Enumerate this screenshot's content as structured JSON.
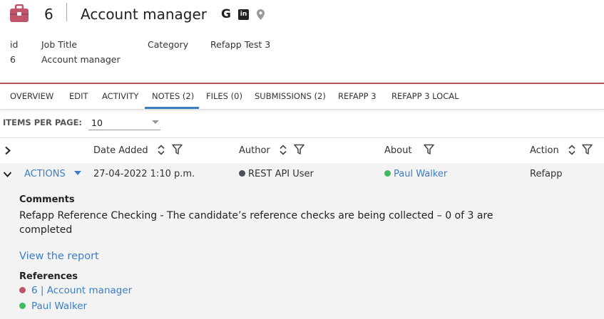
{
  "header": {
    "record_id": "6",
    "title": "Account manager",
    "google_glyph": "G",
    "linkedin_glyph": "in"
  },
  "fields": [
    {
      "label": "id",
      "value": "6"
    },
    {
      "label": "Job Title",
      "value": "Account manager"
    },
    {
      "label": "Category",
      "value": "Refapp Test 3"
    }
  ],
  "tabs": [
    {
      "label": "OVERVIEW"
    },
    {
      "label": "EDIT"
    },
    {
      "label": "ACTIVITY"
    },
    {
      "label": "NOTES (2)",
      "active": true
    },
    {
      "label": "FILES (0)"
    },
    {
      "label": "SUBMISSIONS (2)"
    },
    {
      "label": "REFAPP 3"
    },
    {
      "label": "REFAPP 3 LOCAL"
    }
  ],
  "pagination": {
    "label": "ITEMS PER PAGE:",
    "value": "10"
  },
  "table": {
    "columns": {
      "date_added": "Date Added",
      "author": "Author",
      "about": "About",
      "action": "Action"
    },
    "row": {
      "actions_label": "ACTIONS",
      "date_added": "27-04-2022 1:10 p.m.",
      "author": "REST API User",
      "about": "Paul Walker",
      "action": "Refapp",
      "comments_title": "Comments",
      "comments_text": "Refapp Reference Checking - The candidate’s reference checks are being collected – 0 of 3 are completed",
      "report_link": "View the report",
      "references_title": "References",
      "references": [
        {
          "label": "6 | Account manager",
          "dot_color": "#c0546a"
        },
        {
          "label": "Paul Walker",
          "dot_color": "#3dbb5e"
        }
      ]
    }
  },
  "colors": {
    "brand": "#c0546a",
    "link": "#3b7ec6",
    "author_dot": "#4a4f5a",
    "about_dot": "#3dbb5e"
  }
}
